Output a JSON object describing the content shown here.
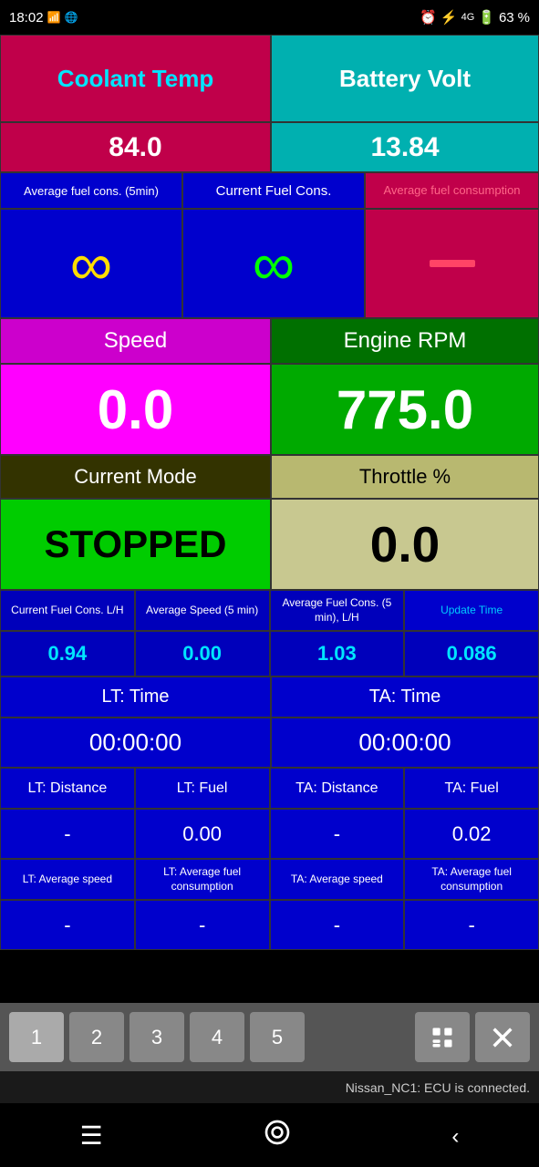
{
  "statusBar": {
    "time": "18:02",
    "batteryLevel": "63"
  },
  "coolant": {
    "label": "Coolant Temp",
    "value": "84.0"
  },
  "battery": {
    "label": "Battery Volt",
    "value": "13.84"
  },
  "fuelCons": {
    "avgLabel": "Average fuel cons. (5min)",
    "currentLabel": "Current Fuel Cons.",
    "avgLabel2": "Average fuel consumption",
    "avgValue": "∞",
    "currentValue": "∞",
    "avgValue2": "—"
  },
  "speed": {
    "label": "Speed",
    "value": "0.0"
  },
  "rpm": {
    "label": "Engine RPM",
    "value": "775.0"
  },
  "mode": {
    "label": "Current Mode",
    "value": "STOPPED"
  },
  "throttle": {
    "label": "Throttle %",
    "value": "0.0"
  },
  "smallStats": {
    "label1": "Current Fuel Cons. L/H",
    "label2": "Average Speed (5 min)",
    "label3": "Average Fuel Cons. (5 min), L/H",
    "label4": "Update Time",
    "value1": "0.94",
    "value2": "0.00",
    "value3": "1.03",
    "value4": "0.086"
  },
  "ltTime": {
    "label": "LT: Time",
    "value": "00:00:00"
  },
  "taTime": {
    "label": "TA: Time",
    "value": "00:00:00"
  },
  "distances": {
    "ltDistLabel": "LT: Distance",
    "ltFuelLabel": "LT: Fuel",
    "taDistLabel": "TA: Distance",
    "taFuelLabel": "TA: Fuel",
    "ltDistValue": "-",
    "ltFuelValue": "0.00",
    "taDistValue": "-",
    "taFuelValue": "0.02"
  },
  "averages": {
    "ltAvgSpeedLabel": "LT: Average speed",
    "ltAvgFuelLabel": "LT: Average fuel consumption",
    "taAvgSpeedLabel": "TA: Average speed",
    "taAvgFuelLabel": "TA: Average fuel consumption",
    "ltAvgSpeedValue": "-",
    "ltAvgFuelValue": "-",
    "taAvgSpeedValue": "-",
    "taAvgFuelValue": "-"
  },
  "tabs": {
    "tab1": "1",
    "tab2": "2",
    "tab3": "3",
    "tab4": "4",
    "tab5": "5"
  },
  "statusMessage": "Nissan_NC1: ECU is connected.",
  "nav": {
    "menu": "☰",
    "home": "⌂",
    "back": "<"
  }
}
